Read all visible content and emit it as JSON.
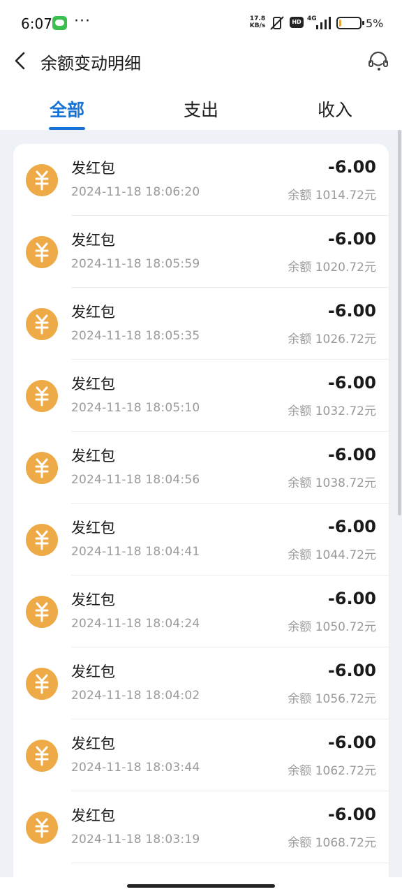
{
  "status_bar": {
    "time": "6:07",
    "dots": "···",
    "speed_value": "17.8",
    "speed_unit": "KB/s",
    "hd": "HD",
    "network": "4G",
    "battery": "5%"
  },
  "header": {
    "title": "余额变动明细"
  },
  "tabs": [
    {
      "label": "全部",
      "active": true
    },
    {
      "label": "支出",
      "active": false
    },
    {
      "label": "收入",
      "active": false
    }
  ],
  "colors": {
    "accent": "#1672d6",
    "icon_bg": "#eeaa47"
  },
  "transactions": [
    {
      "title": "发红包",
      "time": "2024-11-18 18:06:20",
      "amount": "-6.00",
      "balance": "余额 1014.72元"
    },
    {
      "title": "发红包",
      "time": "2024-11-18 18:05:59",
      "amount": "-6.00",
      "balance": "余额 1020.72元"
    },
    {
      "title": "发红包",
      "time": "2024-11-18 18:05:35",
      "amount": "-6.00",
      "balance": "余额 1026.72元"
    },
    {
      "title": "发红包",
      "time": "2024-11-18 18:05:10",
      "amount": "-6.00",
      "balance": "余额 1032.72元"
    },
    {
      "title": "发红包",
      "time": "2024-11-18 18:04:56",
      "amount": "-6.00",
      "balance": "余额 1038.72元"
    },
    {
      "title": "发红包",
      "time": "2024-11-18 18:04:41",
      "amount": "-6.00",
      "balance": "余额 1044.72元"
    },
    {
      "title": "发红包",
      "time": "2024-11-18 18:04:24",
      "amount": "-6.00",
      "balance": "余额 1050.72元"
    },
    {
      "title": "发红包",
      "time": "2024-11-18 18:04:02",
      "amount": "-6.00",
      "balance": "余额 1056.72元"
    },
    {
      "title": "发红包",
      "time": "2024-11-18 18:03:44",
      "amount": "-6.00",
      "balance": "余额 1062.72元"
    },
    {
      "title": "发红包",
      "time": "2024-11-18 18:03:19",
      "amount": "-6.00",
      "balance": "余额 1068.72元"
    }
  ]
}
